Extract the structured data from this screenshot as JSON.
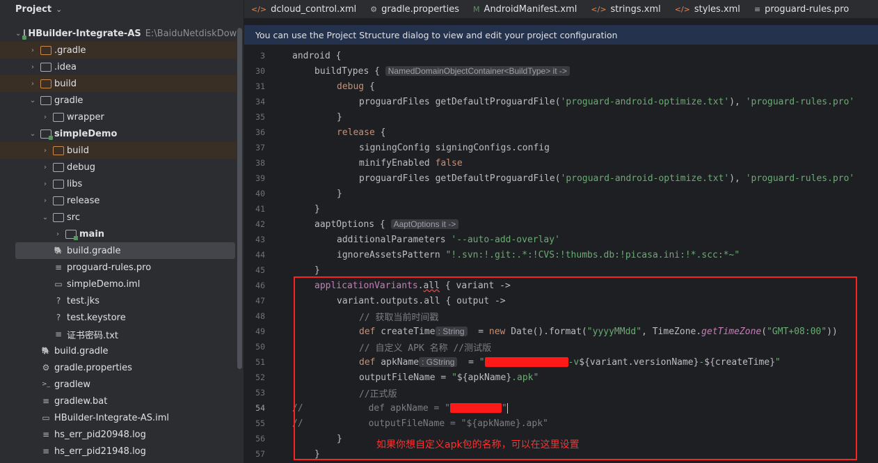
{
  "sidebar": {
    "title": "Project",
    "tree": [
      {
        "label": "HBuilder-Integrate-AS",
        "path": "E:\\BaiduNetdiskDownloa",
        "expanded": true,
        "indent": 0,
        "icon": "module",
        "bold": true
      },
      {
        "label": ".gradle",
        "indent": 1,
        "icon": "folder-orange",
        "excluded": true
      },
      {
        "label": ".idea",
        "indent": 1,
        "icon": "folder"
      },
      {
        "label": "build",
        "indent": 1,
        "icon": "folder-orange",
        "excluded": true
      },
      {
        "label": "gradle",
        "indent": 1,
        "icon": "folder",
        "expanded": true
      },
      {
        "label": "wrapper",
        "indent": 2,
        "icon": "folder"
      },
      {
        "label": "simpleDemo",
        "indent": 1,
        "icon": "module",
        "bold": true,
        "expanded": true
      },
      {
        "label": "build",
        "indent": 2,
        "icon": "folder-orange",
        "excluded": true
      },
      {
        "label": "debug",
        "indent": 2,
        "icon": "folder"
      },
      {
        "label": "libs",
        "indent": 2,
        "icon": "folder"
      },
      {
        "label": "release",
        "indent": 2,
        "icon": "folder"
      },
      {
        "label": "src",
        "indent": 2,
        "icon": "folder",
        "expanded": true
      },
      {
        "label": "main",
        "indent": 3,
        "icon": "src-folder",
        "bold": true
      },
      {
        "label": "build.gradle",
        "indent": 2,
        "icon": "gradle",
        "selected": true,
        "leaf": true
      },
      {
        "label": "proguard-rules.pro",
        "indent": 2,
        "icon": "text",
        "leaf": true
      },
      {
        "label": "simpleDemo.iml",
        "indent": 2,
        "icon": "iml",
        "leaf": true
      },
      {
        "label": "test.jks",
        "indent": 2,
        "icon": "unknown",
        "leaf": true
      },
      {
        "label": "test.keystore",
        "indent": 2,
        "icon": "unknown",
        "leaf": true
      },
      {
        "label": "证书密码.txt",
        "indent": 2,
        "icon": "text",
        "leaf": true
      },
      {
        "label": "build.gradle",
        "indent": 1,
        "icon": "gradle",
        "leaf": true
      },
      {
        "label": "gradle.properties",
        "indent": 1,
        "icon": "gear",
        "leaf": true
      },
      {
        "label": "gradlew",
        "indent": 1,
        "icon": "terminal",
        "leaf": true
      },
      {
        "label": "gradlew.bat",
        "indent": 1,
        "icon": "text",
        "leaf": true
      },
      {
        "label": "HBuilder-Integrate-AS.iml",
        "indent": 1,
        "icon": "iml",
        "leaf": true
      },
      {
        "label": "hs_err_pid20948.log",
        "indent": 1,
        "icon": "text",
        "leaf": true
      },
      {
        "label": "hs_err_pid21948.log",
        "indent": 1,
        "icon": "text",
        "leaf": true
      }
    ]
  },
  "tabs": [
    {
      "label": "dcloud_control.xml",
      "icon": "</>",
      "icon_name": "xml-icon",
      "color": "#e8854e"
    },
    {
      "label": "gradle.properties",
      "icon": "⚙",
      "icon_name": "gear-icon",
      "color": "#b4b8bf"
    },
    {
      "label": "AndroidManifest.xml",
      "icon": "M",
      "icon_name": "manifest-icon",
      "color": "#57965c"
    },
    {
      "label": "strings.xml",
      "icon": "</>",
      "icon_name": "xml-icon",
      "color": "#e8854e"
    },
    {
      "label": "styles.xml",
      "icon": "</>",
      "icon_name": "xml-icon",
      "color": "#e8854e"
    },
    {
      "label": "proguard-rules.pro",
      "icon": "≡",
      "icon_name": "text-file-icon",
      "color": "#b4b8bf"
    }
  ],
  "banner": {
    "text": "You can use the Project Structure dialog to view and edit your project configuration"
  },
  "editor": {
    "lines": [
      {
        "n": "3",
        "html": "<span>android {</span>",
        "indent": 0
      },
      {
        "n": "30",
        "html": "buildTypes { <span class='hint'>NamedDomainObjectContainer&lt;BuildType&gt; it -&gt;</span>",
        "indent": 1
      },
      {
        "n": "31",
        "html": "<span class='kw'>debug</span> {",
        "indent": 2
      },
      {
        "n": "34",
        "html": "proguardFiles getDefaultProguardFile(<span class='str'>'proguard-android-optimize.txt'</span>), <span class='str'>'proguard-rules.pro'</span>",
        "indent": 3
      },
      {
        "n": "35",
        "html": "}",
        "indent": 2
      },
      {
        "n": "36",
        "html": "<span class='kw'>release</span> {",
        "indent": 2
      },
      {
        "n": "37",
        "html": "signingConfig signingConfigs.config",
        "indent": 3
      },
      {
        "n": "38",
        "html": "minifyEnabled <span class='kw'>false</span>",
        "indent": 3
      },
      {
        "n": "39",
        "html": "proguardFiles getDefaultProguardFile(<span class='str'>'proguard-android-optimize.txt'</span>), <span class='str'>'proguard-rules.pro'</span>",
        "indent": 3
      },
      {
        "n": "40",
        "html": "}",
        "indent": 2
      },
      {
        "n": "41",
        "html": "}",
        "indent": 1
      },
      {
        "n": "42",
        "html": "aaptOptions { <span class='hint'>AaptOptions it -&gt;</span>",
        "indent": 1
      },
      {
        "n": "43",
        "html": "additionalParameters <span class='str'>'--auto-add-overlay'</span>",
        "indent": 2
      },
      {
        "n": "44",
        "html": "ignoreAssetsPattern <span class='str'>\"!.svn:!.git:.*:!CVS:!thumbs.db:!picasa.ini:!*.scc:*~\"</span>",
        "indent": 2
      },
      {
        "n": "45",
        "html": "}",
        "indent": 1
      },
      {
        "n": "46",
        "html": "<span class='purple' style='font-style:normal'>applicationVariants</span>.<span class='sq'>all</span> { variant -&gt;",
        "indent": 1
      },
      {
        "n": "47",
        "html": "variant.outputs.all { output -&gt;",
        "indent": 2
      },
      {
        "n": "48",
        "html": "<span class='cmt'>// 获取当前时间戳</span>",
        "indent": 3
      },
      {
        "n": "49",
        "html": "<span class='kw'>def</span> createTime<span class='hint'>: String</span>  = <span class='kw'>new</span> Date().format(<span class='str'>\"yyyyMMdd\"</span>, TimeZone.<span class='purple'>getTimeZone</span>(<span class='str'>\"GMT+08:00\"</span>))",
        "indent": 3
      },
      {
        "n": "50",
        "html": "<span class='cmt'>// 自定义 APK 名称 //测试版</span>",
        "indent": 3
      },
      {
        "n": "51",
        "html": "<span class='kw'>def</span> apkName<span class='hint'>: GString</span>  = <span class='str'>\"<span class='redact' style='width:120px'></span>-v</span>${variant.versionName}<span class='str'>-</span>${createTime}<span class='str'>\"</span>",
        "indent": 3
      },
      {
        "n": "52",
        "html": "outputFileName = <span class='str'>\"</span>${apkName}<span class='str'>.apk\"</span>",
        "indent": 3
      },
      {
        "n": "53",
        "html": "<span class='cmt'>//正式版</span>",
        "indent": 3
      },
      {
        "n": "54",
        "html": "<span class='cmt'>//            def apkName = \"</span><span class='redact' style='width:74px'></span><span class='cmt'>\"</span><span class='cursor'></span>",
        "indent": 0,
        "active": true
      },
      {
        "n": "55",
        "html": "<span class='cmt'>//            outputFileName = \"${apkName}.apk\"</span>",
        "indent": 0
      },
      {
        "n": "56",
        "html": "}",
        "indent": 2
      },
      {
        "n": "57",
        "html": "}",
        "indent": 1
      }
    ]
  },
  "annotation": {
    "text": "如果你想自定义apk包的名称，可以在这里设置",
    "color": "#ff2020"
  }
}
